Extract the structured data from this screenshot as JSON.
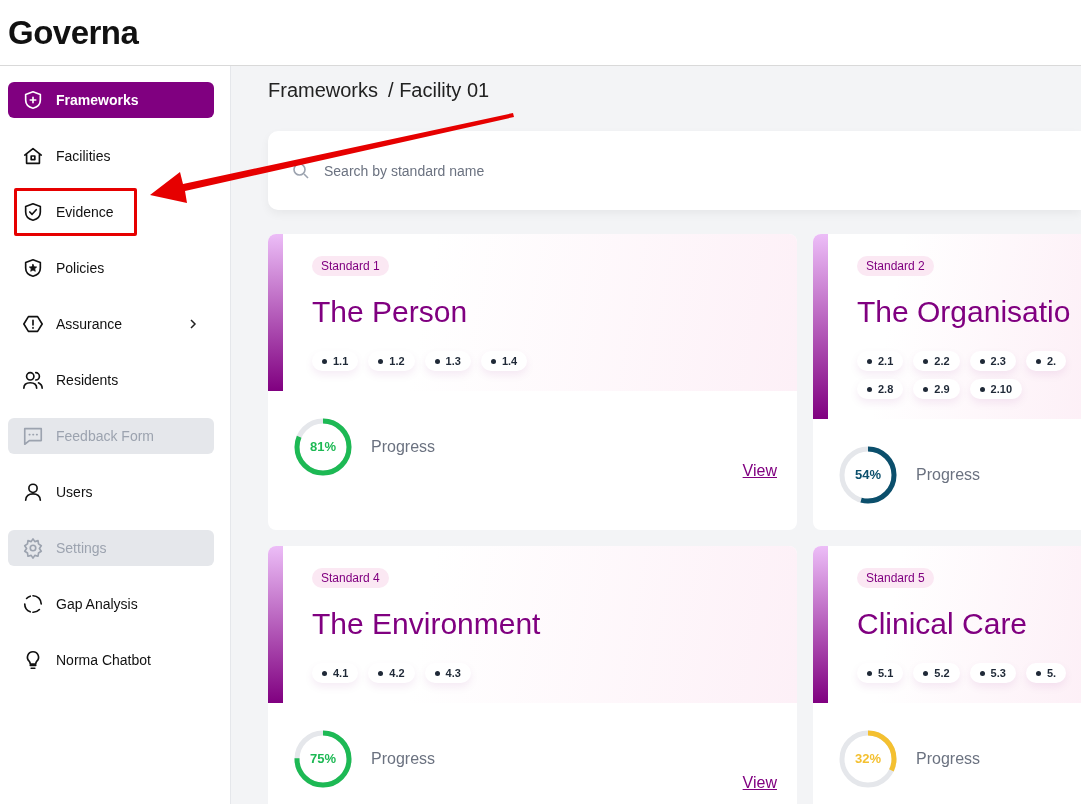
{
  "app": {
    "logo": "Governa"
  },
  "sidebar": {
    "items": [
      {
        "label": "Frameworks",
        "selected": true,
        "disabled": false,
        "highlighted": false,
        "expandable": false
      },
      {
        "label": "Facilities",
        "selected": false,
        "disabled": false,
        "highlighted": false,
        "expandable": false
      },
      {
        "label": "Evidence",
        "selected": false,
        "disabled": false,
        "highlighted": true,
        "expandable": false
      },
      {
        "label": "Policies",
        "selected": false,
        "disabled": false,
        "highlighted": false,
        "expandable": false
      },
      {
        "label": "Assurance",
        "selected": false,
        "disabled": false,
        "highlighted": false,
        "expandable": true
      },
      {
        "label": "Residents",
        "selected": false,
        "disabled": false,
        "highlighted": false,
        "expandable": false
      },
      {
        "label": "Feedback Form",
        "selected": false,
        "disabled": true,
        "highlighted": false,
        "expandable": false
      },
      {
        "label": "Users",
        "selected": false,
        "disabled": false,
        "highlighted": false,
        "expandable": false
      },
      {
        "label": "Settings",
        "selected": false,
        "disabled": true,
        "highlighted": false,
        "expandable": false
      },
      {
        "label": "Gap Analysis",
        "selected": false,
        "disabled": false,
        "highlighted": false,
        "expandable": false
      },
      {
        "label": "Norma Chatbot",
        "selected": false,
        "disabled": false,
        "highlighted": false,
        "expandable": false
      }
    ]
  },
  "breadcrumb": {
    "parts": [
      "Frameworks",
      "/ Facility 01"
    ]
  },
  "search": {
    "placeholder": "Search by standard name"
  },
  "standards": [
    {
      "badge": "Standard 1",
      "title": "The Person",
      "chip_rows": [
        [
          "1.1",
          "1.2",
          "1.3",
          "1.4"
        ]
      ],
      "level": 0.81,
      "percent": "81%",
      "color": "#1db954",
      "progress_label": "Progress",
      "link": "View"
    },
    {
      "badge": "Standard 2",
      "title": "The Organisatio",
      "chip_rows": [
        [
          "2.1",
          "2.2",
          "2.3",
          "2."
        ],
        [
          "2.8",
          "2.9",
          "2.10"
        ]
      ],
      "level": 0.54,
      "percent": "54%",
      "color": "#0b4f6c",
      "progress_label": "Progress"
    },
    {
      "badge": "Standard 4",
      "title": "The Environment",
      "chip_rows": [
        [
          "4.1",
          "4.2",
          "4.3"
        ]
      ],
      "level": 0.75,
      "percent": "75%",
      "color": "#1db954",
      "progress_label": "Progress",
      "link": "View"
    },
    {
      "badge": "Standard 5",
      "title": "Clinical Care",
      "chip_rows": [
        [
          "5.1",
          "5.2",
          "5.3",
          "5."
        ]
      ],
      "level": 0.32,
      "percent": "32%",
      "color": "#f4c030",
      "progress_label": "Progress"
    }
  ]
}
